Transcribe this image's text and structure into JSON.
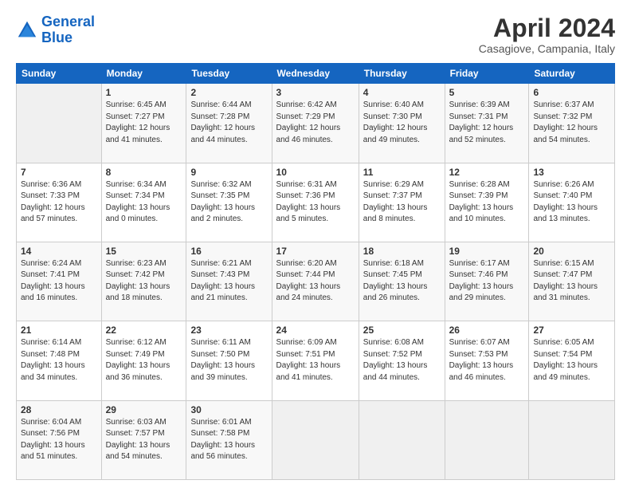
{
  "header": {
    "logo_line1": "General",
    "logo_line2": "Blue",
    "title": "April 2024",
    "subtitle": "Casagiove, Campania, Italy"
  },
  "columns": [
    "Sunday",
    "Monday",
    "Tuesday",
    "Wednesday",
    "Thursday",
    "Friday",
    "Saturday"
  ],
  "weeks": [
    [
      {
        "num": "",
        "info": ""
      },
      {
        "num": "1",
        "info": "Sunrise: 6:45 AM\nSunset: 7:27 PM\nDaylight: 12 hours\nand 41 minutes."
      },
      {
        "num": "2",
        "info": "Sunrise: 6:44 AM\nSunset: 7:28 PM\nDaylight: 12 hours\nand 44 minutes."
      },
      {
        "num": "3",
        "info": "Sunrise: 6:42 AM\nSunset: 7:29 PM\nDaylight: 12 hours\nand 46 minutes."
      },
      {
        "num": "4",
        "info": "Sunrise: 6:40 AM\nSunset: 7:30 PM\nDaylight: 12 hours\nand 49 minutes."
      },
      {
        "num": "5",
        "info": "Sunrise: 6:39 AM\nSunset: 7:31 PM\nDaylight: 12 hours\nand 52 minutes."
      },
      {
        "num": "6",
        "info": "Sunrise: 6:37 AM\nSunset: 7:32 PM\nDaylight: 12 hours\nand 54 minutes."
      }
    ],
    [
      {
        "num": "7",
        "info": "Sunrise: 6:36 AM\nSunset: 7:33 PM\nDaylight: 12 hours\nand 57 minutes."
      },
      {
        "num": "8",
        "info": "Sunrise: 6:34 AM\nSunset: 7:34 PM\nDaylight: 13 hours\nand 0 minutes."
      },
      {
        "num": "9",
        "info": "Sunrise: 6:32 AM\nSunset: 7:35 PM\nDaylight: 13 hours\nand 2 minutes."
      },
      {
        "num": "10",
        "info": "Sunrise: 6:31 AM\nSunset: 7:36 PM\nDaylight: 13 hours\nand 5 minutes."
      },
      {
        "num": "11",
        "info": "Sunrise: 6:29 AM\nSunset: 7:37 PM\nDaylight: 13 hours\nand 8 minutes."
      },
      {
        "num": "12",
        "info": "Sunrise: 6:28 AM\nSunset: 7:39 PM\nDaylight: 13 hours\nand 10 minutes."
      },
      {
        "num": "13",
        "info": "Sunrise: 6:26 AM\nSunset: 7:40 PM\nDaylight: 13 hours\nand 13 minutes."
      }
    ],
    [
      {
        "num": "14",
        "info": "Sunrise: 6:24 AM\nSunset: 7:41 PM\nDaylight: 13 hours\nand 16 minutes."
      },
      {
        "num": "15",
        "info": "Sunrise: 6:23 AM\nSunset: 7:42 PM\nDaylight: 13 hours\nand 18 minutes."
      },
      {
        "num": "16",
        "info": "Sunrise: 6:21 AM\nSunset: 7:43 PM\nDaylight: 13 hours\nand 21 minutes."
      },
      {
        "num": "17",
        "info": "Sunrise: 6:20 AM\nSunset: 7:44 PM\nDaylight: 13 hours\nand 24 minutes."
      },
      {
        "num": "18",
        "info": "Sunrise: 6:18 AM\nSunset: 7:45 PM\nDaylight: 13 hours\nand 26 minutes."
      },
      {
        "num": "19",
        "info": "Sunrise: 6:17 AM\nSunset: 7:46 PM\nDaylight: 13 hours\nand 29 minutes."
      },
      {
        "num": "20",
        "info": "Sunrise: 6:15 AM\nSunset: 7:47 PM\nDaylight: 13 hours\nand 31 minutes."
      }
    ],
    [
      {
        "num": "21",
        "info": "Sunrise: 6:14 AM\nSunset: 7:48 PM\nDaylight: 13 hours\nand 34 minutes."
      },
      {
        "num": "22",
        "info": "Sunrise: 6:12 AM\nSunset: 7:49 PM\nDaylight: 13 hours\nand 36 minutes."
      },
      {
        "num": "23",
        "info": "Sunrise: 6:11 AM\nSunset: 7:50 PM\nDaylight: 13 hours\nand 39 minutes."
      },
      {
        "num": "24",
        "info": "Sunrise: 6:09 AM\nSunset: 7:51 PM\nDaylight: 13 hours\nand 41 minutes."
      },
      {
        "num": "25",
        "info": "Sunrise: 6:08 AM\nSunset: 7:52 PM\nDaylight: 13 hours\nand 44 minutes."
      },
      {
        "num": "26",
        "info": "Sunrise: 6:07 AM\nSunset: 7:53 PM\nDaylight: 13 hours\nand 46 minutes."
      },
      {
        "num": "27",
        "info": "Sunrise: 6:05 AM\nSunset: 7:54 PM\nDaylight: 13 hours\nand 49 minutes."
      }
    ],
    [
      {
        "num": "28",
        "info": "Sunrise: 6:04 AM\nSunset: 7:56 PM\nDaylight: 13 hours\nand 51 minutes."
      },
      {
        "num": "29",
        "info": "Sunrise: 6:03 AM\nSunset: 7:57 PM\nDaylight: 13 hours\nand 54 minutes."
      },
      {
        "num": "30",
        "info": "Sunrise: 6:01 AM\nSunset: 7:58 PM\nDaylight: 13 hours\nand 56 minutes."
      },
      {
        "num": "",
        "info": ""
      },
      {
        "num": "",
        "info": ""
      },
      {
        "num": "",
        "info": ""
      },
      {
        "num": "",
        "info": ""
      }
    ]
  ]
}
